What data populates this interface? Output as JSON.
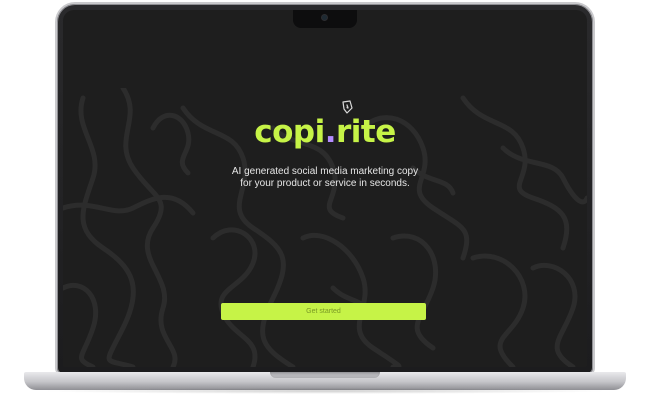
{
  "app": {
    "logo": {
      "prefix": "copi",
      "dot": ".",
      "suffix": "rite",
      "mark_icon": "pen-nib-icon"
    },
    "tagline": {
      "line1": "AI generated social media marketing copy",
      "line2": "for your product or service in seconds."
    },
    "cta_label": "Get started"
  },
  "colors": {
    "accent": "#c6f347",
    "logo_dot": "#b48cff",
    "background": "#1e1e1e",
    "doodle": "#2c2c2c",
    "text": "#e6e6e6"
  }
}
